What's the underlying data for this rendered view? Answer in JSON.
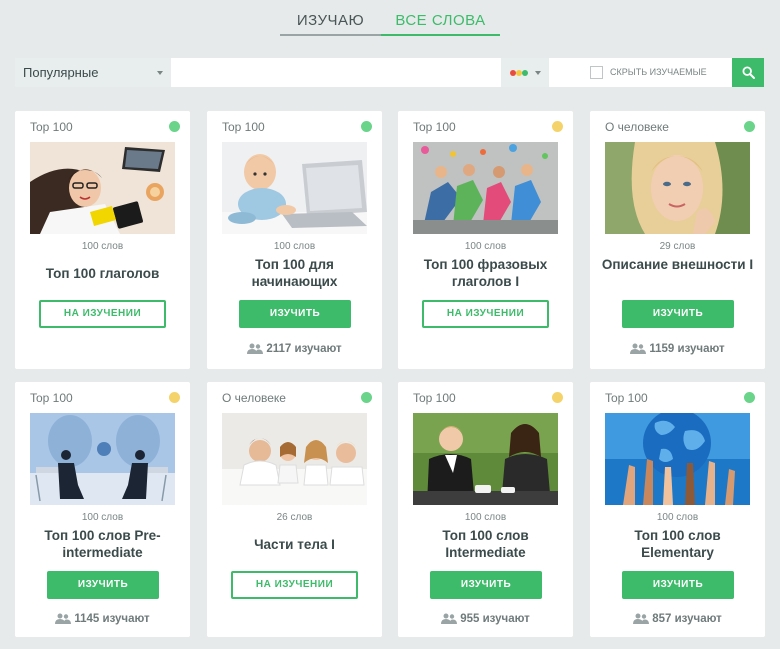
{
  "tabs": [
    {
      "label": "ИЗУЧАЮ",
      "active": false
    },
    {
      "label": "ВСЕ СЛОВА",
      "active": true
    }
  ],
  "filters": {
    "sort_selected": "Популярные",
    "search_value": "",
    "search_placeholder": "",
    "level_dots": [
      "#e84c3d",
      "#f5c842",
      "#3dbb6a"
    ],
    "hide_learned_label": "СКРЫТЬ ИЗУЧАЕМЫЕ",
    "hide_learned_checked": false,
    "search_button_icon": "search-icon"
  },
  "colors": {
    "accent": "#3dbb6a",
    "level_green": "#69d48a",
    "level_yellow": "#f5d36b"
  },
  "cards": [
    {
      "category": "Top 100",
      "level": "green",
      "image": "woman-laptop-photo",
      "count": "100 слов",
      "title": "Топ 100 глаголов",
      "button": "НА ИЗУЧЕНИИ",
      "learning": true,
      "learners": ""
    },
    {
      "category": "Top 100",
      "level": "green",
      "image": "baby-laptop-photo",
      "count": "100 слов",
      "title": "Топ 100 для начинающих",
      "button": "ИЗУЧИТЬ",
      "learning": false,
      "learners": "2117 изучают"
    },
    {
      "category": "Top 100",
      "level": "yellow",
      "image": "people-lying-photo",
      "count": "100 слов",
      "title": "Топ 100 фразовых глаголов I",
      "button": "НА ИЗУЧЕНИИ",
      "learning": true,
      "learners": ""
    },
    {
      "category": "О человеке",
      "level": "green",
      "image": "woman-face-photo",
      "count": "29 слов",
      "title": "Описание внешности I",
      "button": "ИЗУЧИТЬ",
      "learning": false,
      "learners": "1159 изучают"
    },
    {
      "category": "Top 100",
      "level": "yellow",
      "image": "business-meeting-photo",
      "count": "100 слов",
      "title": "Топ 100 слов Pre-intermediate",
      "button": "ИЗУЧИТЬ",
      "learning": false,
      "learners": "1145 изучают"
    },
    {
      "category": "О человеке",
      "level": "green",
      "image": "family-photo",
      "count": "26 слов",
      "title": "Части тела I",
      "button": "НА ИЗУЧЕНИИ",
      "learning": true,
      "learners": ""
    },
    {
      "category": "Top 100",
      "level": "yellow",
      "image": "two-women-talking-photo",
      "count": "100 слов",
      "title": "Топ 100 слов Intermediate",
      "button": "ИЗУЧИТЬ",
      "learning": false,
      "learners": "955 изучают"
    },
    {
      "category": "Top 100",
      "level": "green",
      "image": "globe-hands-photo",
      "count": "100 слов",
      "title": "Топ 100 слов Elementary",
      "button": "ИЗУЧИТЬ",
      "learning": false,
      "learners": "857 изучают"
    }
  ]
}
